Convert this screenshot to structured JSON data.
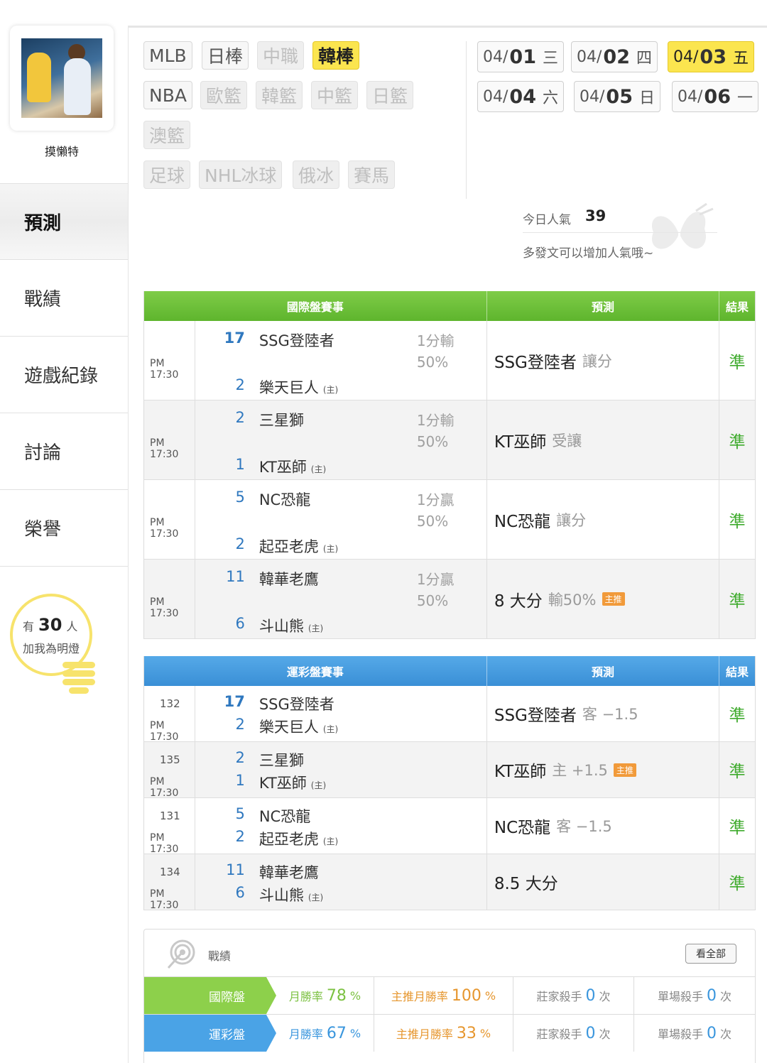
{
  "user": {
    "name": "摸懶特"
  },
  "nav": [
    {
      "label": "預測",
      "active": true
    },
    {
      "label": "戰績",
      "active": false
    },
    {
      "label": "遊戲紀錄",
      "active": false
    },
    {
      "label": "討論",
      "active": false
    },
    {
      "label": "榮譽",
      "active": false
    }
  ],
  "lights": {
    "prefix": "有",
    "count": "30",
    "suffix": "人",
    "cta": "加我為明燈"
  },
  "leagues": [
    {
      "label": "MLB",
      "state": "normal"
    },
    {
      "label": "日棒",
      "state": "normal"
    },
    {
      "label": "中職",
      "state": "dim"
    },
    {
      "label": "韓棒",
      "state": "selected"
    },
    {
      "label": "NBA",
      "state": "normal"
    },
    {
      "label": "歐籃",
      "state": "dim"
    },
    {
      "label": "韓籃",
      "state": "dim"
    },
    {
      "label": "中籃",
      "state": "dim"
    },
    {
      "label": "日籃",
      "state": "dim"
    },
    {
      "label": "澳籃",
      "state": "dim"
    },
    {
      "label": "足球",
      "state": "dim"
    },
    {
      "label": "NHL冰球",
      "state": "dim"
    },
    {
      "label": "俄冰",
      "state": "dim"
    },
    {
      "label": "賽馬",
      "state": "dim"
    }
  ],
  "dates": [
    {
      "prefix": "04/",
      "day": "01",
      "weekday": "三",
      "selected": false
    },
    {
      "prefix": "04/",
      "day": "02",
      "weekday": "四",
      "selected": false
    },
    {
      "prefix": "04/",
      "day": "03",
      "weekday": "五",
      "selected": true
    },
    {
      "prefix": "04/",
      "day": "04",
      "weekday": "六",
      "selected": false
    },
    {
      "prefix": "04/",
      "day": "05",
      "weekday": "日",
      "selected": false
    },
    {
      "prefix": "04/",
      "day": "06",
      "weekday": "一",
      "selected": false
    }
  ],
  "popularity": {
    "label": "今日人氣",
    "value": "39",
    "hint": "多發文可以增加人氣哦~"
  },
  "intl_table": {
    "headers": [
      "國際盤賽事",
      "預測",
      "結果"
    ],
    "rows": [
      {
        "time": "PM 17:30",
        "away_score": "17",
        "away": "SSG登陸者",
        "home_score": "2",
        "home": "樂天巨人",
        "home_mark": "(主)",
        "line": "1分輸",
        "pct": "50%",
        "pred": "SSG登陸者",
        "pred_sub": "讓分",
        "badge": "",
        "result": "準"
      },
      {
        "time": "PM 17:30",
        "away_score": "2",
        "away": "三星獅",
        "home_score": "1",
        "home": "KT巫師",
        "home_mark": "(主)",
        "line": "1分輸",
        "pct": "50%",
        "pred": "KT巫師",
        "pred_sub": "受讓",
        "badge": "",
        "result": "準"
      },
      {
        "time": "PM 17:30",
        "away_score": "5",
        "away": "NC恐龍",
        "home_score": "2",
        "home": "起亞老虎",
        "home_mark": "(主)",
        "line": "1分贏",
        "pct": "50%",
        "pred": "NC恐龍",
        "pred_sub": "讓分",
        "badge": "",
        "result": "準"
      },
      {
        "time": "PM 17:30",
        "away_score": "11",
        "away": "韓華老鷹",
        "home_score": "6",
        "home": "斗山熊",
        "home_mark": "(主)",
        "line": "1分贏",
        "pct": "50%",
        "pred": "8 大分",
        "pred_sub": "輸50%",
        "badge": "主推",
        "result": "準"
      }
    ]
  },
  "lottery_table": {
    "headers": [
      "運彩盤賽事",
      "預測",
      "結果"
    ],
    "rows": [
      {
        "num": "132",
        "time": "PM 17:30",
        "away_score": "17",
        "away": "SSG登陸者",
        "home_score": "2",
        "home": "樂天巨人",
        "home_mark": "(主)",
        "pred": "SSG登陸者",
        "pred_sub": "客 −1.5",
        "badge": "",
        "result": "準"
      },
      {
        "num": "135",
        "time": "PM 17:30",
        "away_score": "2",
        "away": "三星獅",
        "home_score": "1",
        "home": "KT巫師",
        "home_mark": "(主)",
        "pred": "KT巫師",
        "pred_sub": "主 +1.5",
        "badge": "主推",
        "result": "準"
      },
      {
        "num": "131",
        "time": "PM 17:30",
        "away_score": "5",
        "away": "NC恐龍",
        "home_score": "2",
        "home": "起亞老虎",
        "home_mark": "(主)",
        "pred": "NC恐龍",
        "pred_sub": "客 −1.5",
        "badge": "",
        "result": "準"
      },
      {
        "num": "134",
        "time": "PM 17:30",
        "away_score": "11",
        "away": "韓華老鷹",
        "home_score": "6",
        "home": "斗山熊",
        "home_mark": "(主)",
        "pred": "8.5 大分",
        "pred_sub": "",
        "badge": "",
        "result": "準"
      }
    ]
  },
  "record": {
    "title": "戰績",
    "view_all": "看全部",
    "rows": [
      {
        "label": "國際盤",
        "monthly_label": "月勝率",
        "monthly": "78",
        "main_label": "主推月勝率",
        "main": "100",
        "pct": "%",
        "banker_label": "莊家殺手",
        "banker": "0",
        "single_label": "單場殺手",
        "single": "0",
        "times": "次"
      },
      {
        "label": "運彩盤",
        "monthly_label": "月勝率",
        "monthly": "67",
        "main_label": "主推月勝率",
        "main": "33",
        "pct": "%",
        "banker_label": "莊家殺手",
        "banker": "0",
        "single_label": "單場殺手",
        "single": "0",
        "times": "次"
      }
    ]
  },
  "colors": {
    "accent_yellow": "#fbe54f",
    "header_green": "#6cbf3a",
    "header_blue": "#4aa3e6",
    "result_green": "#3fab2d",
    "score_blue": "#2f78bf",
    "badge_orange": "#f19a3a"
  }
}
